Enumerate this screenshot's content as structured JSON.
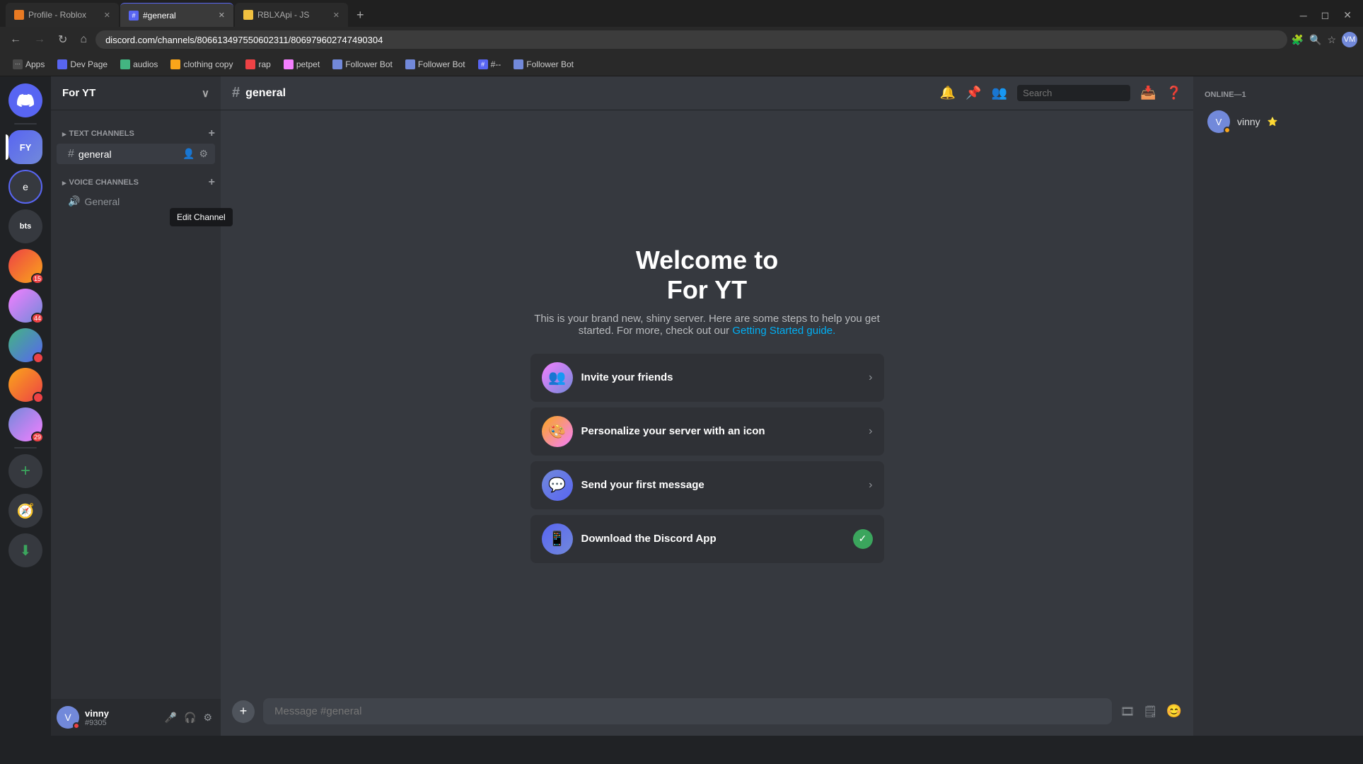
{
  "browser": {
    "tabs": [
      {
        "label": "Profile - Roblox",
        "favicon_color": "#e87a23",
        "active": false
      },
      {
        "label": "#general",
        "favicon_color": "#5865f2",
        "active": true
      },
      {
        "label": "RBLXApi - JS",
        "favicon_color": "#f0c040",
        "active": false
      }
    ],
    "address": "discord.com/channels/806613497550602311/806979602747490304",
    "new_tab_label": "+"
  },
  "bookmarks": [
    {
      "label": "Apps",
      "color": "#7289da"
    },
    {
      "label": "Dev Page",
      "color": "#5865f2"
    },
    {
      "label": "audios",
      "color": "#43b581"
    },
    {
      "label": "clothing copy",
      "color": "#faa61a"
    },
    {
      "label": "rap",
      "color": "#ed4245"
    },
    {
      "label": "petpet",
      "color": "#f47fff"
    },
    {
      "label": "Follower Bot",
      "color": "#7289da"
    },
    {
      "label": "Follower Bot",
      "color": "#7289da"
    },
    {
      "label": "#--",
      "color": "#5865f2"
    },
    {
      "label": "Follower Bot",
      "color": "#7289da"
    }
  ],
  "discord": {
    "server_name": "For YT",
    "channel_name": "general",
    "text_channels_label": "Text Channels",
    "voice_channels_label": "Voice Channels",
    "channels": [
      {
        "name": "general",
        "type": "text",
        "active": true
      }
    ],
    "voice_channels": [
      {
        "name": "General",
        "type": "voice"
      }
    ],
    "edit_channel_tooltip": "Edit Channel",
    "welcome_title": "Welcome to\nFor YT",
    "welcome_title_line1": "Welcome to",
    "welcome_title_line2": "For YT",
    "welcome_text": "This is your brand new, shiny server. Here are some steps to help you get started. For more, check out our ",
    "welcome_link": "Getting Started guide.",
    "action_cards": [
      {
        "label": "Invite your friends",
        "icon": "👥",
        "gradient": "invite",
        "has_check": false
      },
      {
        "label": "Personalize your server with an icon",
        "icon": "🎨",
        "gradient": "personalize",
        "has_check": false
      },
      {
        "label": "Send your first message",
        "icon": "💬",
        "gradient": "message",
        "has_check": false
      },
      {
        "label": "Download the Discord App",
        "icon": "📱",
        "gradient": "download",
        "has_check": true
      }
    ],
    "message_placeholder": "Message #general",
    "online_header": "ONLINE—1",
    "members": [
      {
        "name": "vinny",
        "discriminator": "#9305",
        "badge": "⭐",
        "status": "online_yellow"
      }
    ],
    "user": {
      "name": "vinny",
      "discriminator": "#9305",
      "status": "dnd"
    },
    "search_placeholder": "Search"
  }
}
